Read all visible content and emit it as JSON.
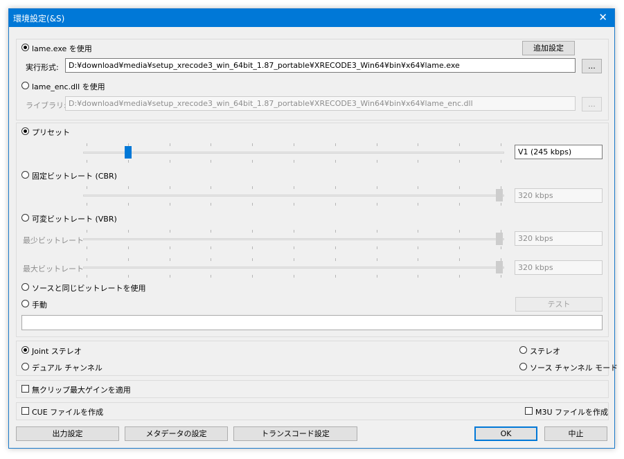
{
  "window": {
    "title": "環境設定(&S)",
    "close_glyph": "✕"
  },
  "encoder": {
    "lame_exe_label": "lame.exe を使用",
    "extra_settings_button": "追加設定",
    "exe_format_label": "実行形式:",
    "exe_path": "D:¥download¥media¥setup_xrecode3_win_64bit_1.87_portable¥XRECODE3_Win64¥bin¥x64¥lame.exe",
    "browse_button": "...",
    "lame_dll_label": "lame_enc.dll を使用",
    "library_label": "ライブラリ:",
    "dll_path": "D:¥download¥media¥setup_xrecode3_win_64bit_1.87_portable¥XRECODE3_Win64¥bin¥x64¥lame_enc.dll",
    "selected": "lame_exe"
  },
  "bitrate": {
    "preset_label": "プリセット",
    "preset_value": "V1 (245 kbps)",
    "preset_slider_position": 0.1,
    "cbr_label": "固定ビットレート (CBR)",
    "cbr_value": "320 kbps",
    "vbr_label": "可変ビットレート (VBR)",
    "vbr_min_label": "最少ビットレート",
    "vbr_min_value": "320 kbps",
    "vbr_max_label": "最大ビットレート",
    "vbr_max_value": "320 kbps",
    "source_label": "ソースと同じビットレートを使用",
    "manual_label": "手動",
    "test_button": "テスト",
    "manual_value": "",
    "selected": "preset"
  },
  "channel": {
    "joint_stereo": "Joint ステレオ",
    "stereo": "ステレオ",
    "dual_channel": "デュアル チャンネル",
    "source_channel_mode": "ソース チャンネル モード",
    "selected": "joint_stereo"
  },
  "options": {
    "noclip_gain": "無クリップ最大ゲインを適用",
    "noclip_checked": false,
    "cue_file": "CUE ファイルを作成",
    "cue_checked": false,
    "m3u_file": "M3U ファイルを作成",
    "m3u_checked": false
  },
  "footer": {
    "output_settings": "出力設定",
    "metadata_settings": "メタデータの設定",
    "transcode_settings": "トランスコード設定",
    "ok": "OK",
    "cancel": "中止"
  }
}
